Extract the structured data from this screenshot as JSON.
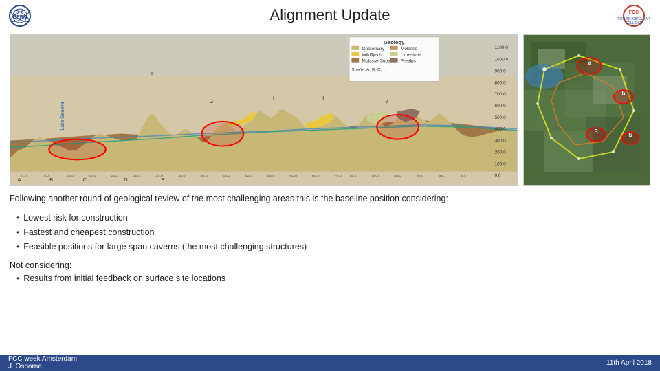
{
  "header": {
    "title": "Alignment Update"
  },
  "footer": {
    "left_line1": "FCC week Amsterdam",
    "left_line2": "J. Osborne",
    "right_text": "11th April 2018"
  },
  "legend": {
    "title": "Geology",
    "items": [
      {
        "label": "Quaternary",
        "color": "#c8b878"
      },
      {
        "label": "Wildflysch",
        "color": "#e8c840"
      },
      {
        "label": "Molasse Subalpin",
        "color": "#a07848"
      },
      {
        "label": "Molasse",
        "color": "#c09060"
      },
      {
        "label": "Limestone",
        "color": "#c8d090"
      },
      {
        "label": "Prealps",
        "color": "#907060"
      }
    ],
    "shafts": "Shafts: A, B, C, ..."
  },
  "y_axis_labels": [
    "1100.0",
    "1000.0",
    "900.0",
    "800.0",
    "700.0",
    "600.0",
    "500.0",
    "400.0",
    "300.0",
    "200.0",
    "100.0",
    "0.0"
  ],
  "content": {
    "intro": "Following another round of geological review of the most challenging areas this is the baseline position considering:",
    "bullets": [
      "Lowest risk for construction",
      "Fastest and cheapest construction",
      "Feasible positions for large span caverns (the most challenging structures)"
    ],
    "not_considering_label": "Not considering:",
    "not_considering_bullets": [
      "Results from initial feedback on surface site locations"
    ]
  },
  "x_labels": [
    "A",
    "B",
    "C",
    "D",
    "E",
    "F",
    "G",
    "H",
    "I",
    "J",
    "L"
  ]
}
